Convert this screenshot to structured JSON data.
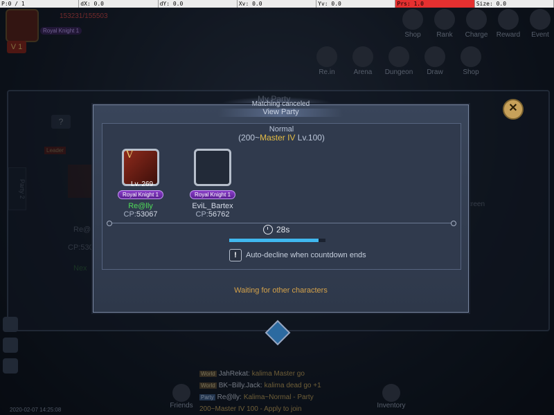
{
  "debug_bar": [
    "P:0 / 1",
    "dX: 0.0",
    "dY: 0.0",
    "Xv: 0.0",
    "Yv: 0.0",
    "Prs: 1.0",
    "Size: 0.0"
  ],
  "hud": {
    "hp": "153231/155503",
    "level_badge": "V 1",
    "rank_top": "Royal Knight 1",
    "menu_row1": [
      "Shop",
      "Rank",
      "Charge",
      "Reward",
      "Event"
    ],
    "menu_row2": [
      "Re.in",
      "Arena",
      "Dungeon",
      "Draw",
      "Shop"
    ]
  },
  "back_dialog": {
    "title": "My Party",
    "help_label": "?",
    "leader_tag": "Leader",
    "name": "Re@",
    "cp": "CP:530",
    "next": "Nex",
    "side_tab": "Party 2",
    "screen_text": "screen"
  },
  "dialog": {
    "matching_status": "Matching canceled",
    "title": "View Party",
    "mode": "Normal",
    "rank_prefix": "(200~",
    "rank_name": "Master IV",
    "rank_suffix": " Lv.100)",
    "members": [
      {
        "name": "Re@lly",
        "cp_label": "CP:",
        "cp": "53067",
        "rank": "Royal Knight 1",
        "level": "Lv. 269",
        "portrait_v": "V"
      },
      {
        "name": "EviL_Bartex",
        "cp_label": "CP:",
        "cp": "56762",
        "rank": "Royal Knight 1",
        "level": "",
        "portrait_v": ""
      }
    ],
    "timer": "28s",
    "countdown_fraction": 0.93,
    "auto_decline": "Auto-decline when countdown ends",
    "waiting": "Waiting for other characters",
    "close_label": "✕"
  },
  "chat": [
    {
      "tag": "World",
      "name": "JahRekat:",
      "msg": "kalima Master go"
    },
    {
      "tag": "World",
      "name": "BK~Billy.Jack:",
      "msg": "kalima dead go +1"
    },
    {
      "tag": "Party",
      "name": "Re@lly:",
      "msg": "Kalima~Normal - Party"
    },
    {
      "tag": "",
      "name": "",
      "msg": "200~Master IV 100 - Apply to join"
    }
  ],
  "bottom": {
    "friends": "Friends",
    "inventory": "Inventory",
    "timestamp": "2020-02-07 14:25:08"
  },
  "colors": {
    "accent_gold": "#e6be45",
    "progress": "#40b8ef",
    "name_green": "#4fdc58"
  }
}
